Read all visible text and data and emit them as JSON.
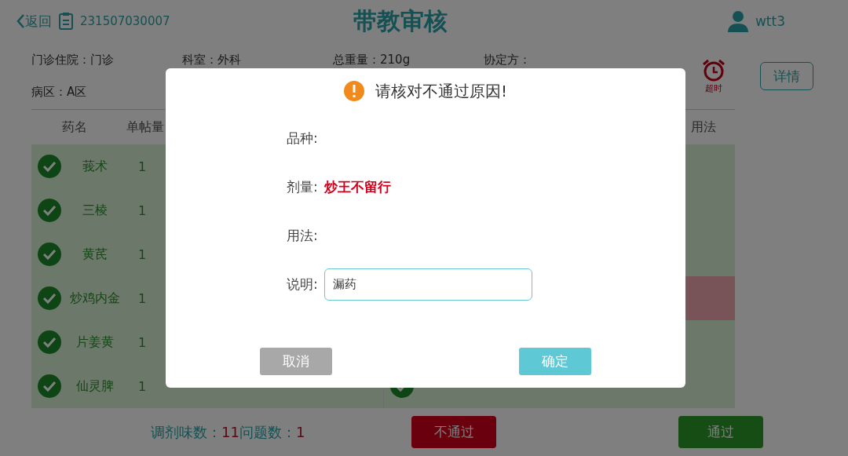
{
  "header": {
    "back_label": "返回",
    "order_number": "231507030007",
    "title": "带教审核",
    "user": "wtt3"
  },
  "info": [
    "门诊住院：门诊",
    "科室：外科",
    "总重量：210g",
    "协定方：",
    "病区：A区"
  ],
  "timeout": {
    "label": "超时"
  },
  "detail_button": "详情",
  "table": {
    "left_columns": [
      "药名",
      "单帖量"
    ],
    "right_columns": [
      "用法"
    ],
    "rows": [
      {
        "name": "莪术",
        "qty": "1",
        "checked": true
      },
      {
        "name": "三棱",
        "qty": "1",
        "checked": true
      },
      {
        "name": "黄芪",
        "qty": "1",
        "checked": true
      },
      {
        "name": "炒鸡内金",
        "qty": "1",
        "checked": true
      },
      {
        "name": "片姜黄",
        "qty": "1",
        "checked": true
      },
      {
        "name": "仙灵脾",
        "qty": "1",
        "checked": true
      }
    ],
    "right_rows": [
      {
        "flagged": false
      },
      {
        "flagged": false
      },
      {
        "flagged": false
      },
      {
        "flagged": true
      },
      {
        "flagged": false
      },
      {
        "flagged": false,
        "checked": true
      }
    ]
  },
  "footer": {
    "count_label": "调剂味数：",
    "count": "11",
    "issues_label": "问题数：",
    "issues": "1",
    "reject": "不通过",
    "approve": "通过"
  },
  "dialog": {
    "title": "请核对不通过原因!",
    "fields": [
      {
        "kind": "text",
        "label": "品种:"
      },
      {
        "kind": "alert",
        "label": "剂量:",
        "value": "炒王不留行"
      },
      {
        "kind": "text",
        "label": "用法:"
      },
      {
        "kind": "input",
        "label": "说明:",
        "value": "漏药"
      }
    ],
    "cancel": "取消",
    "confirm": "确定"
  }
}
